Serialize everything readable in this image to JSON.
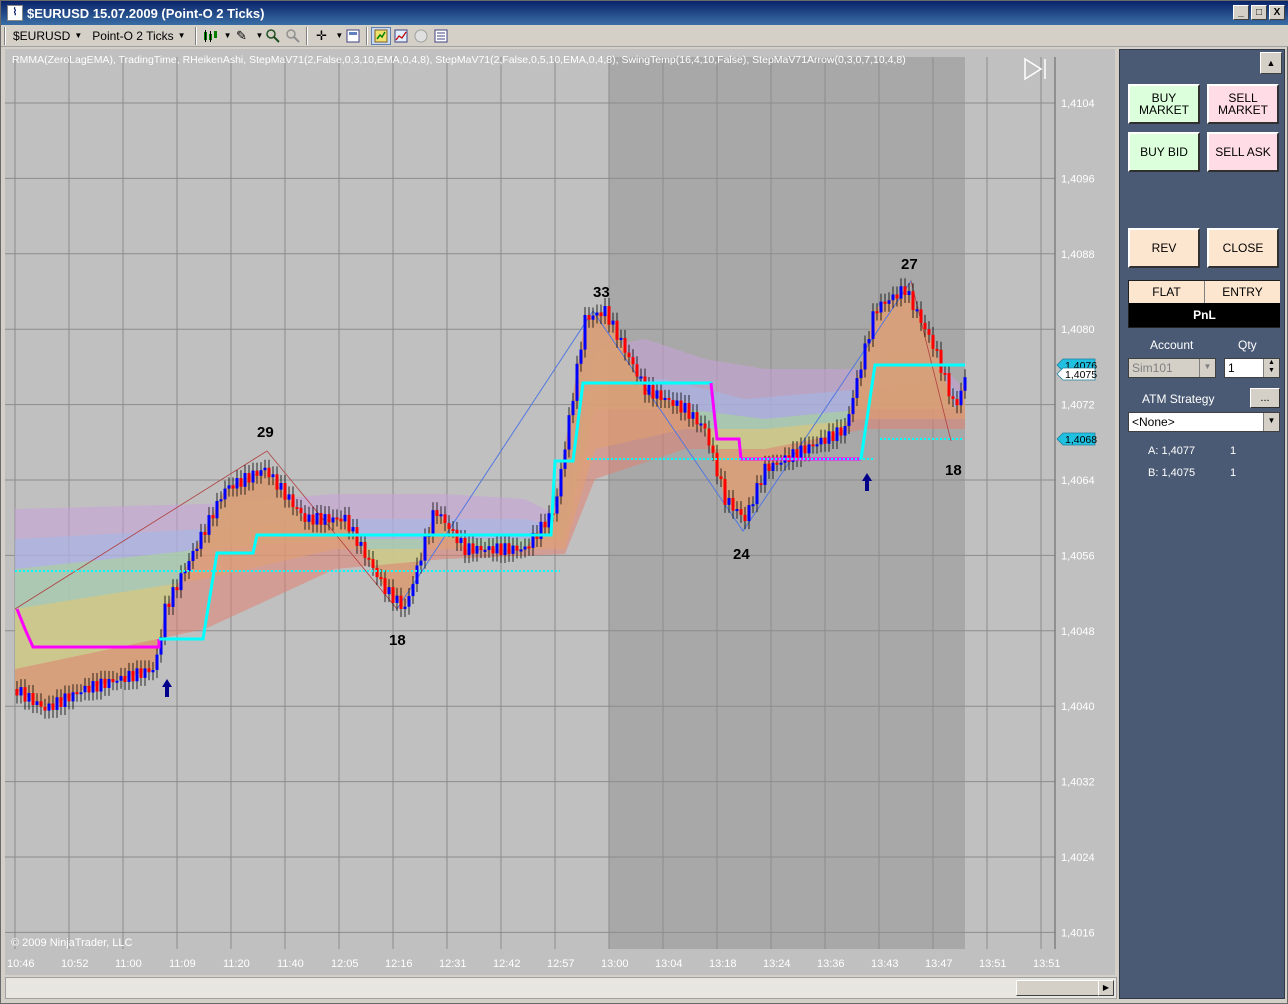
{
  "window": {
    "title": "$EURUSD  15.07.2009 (Point-O 2 Ticks)",
    "controls": [
      "_",
      "□",
      "X"
    ]
  },
  "toolbar": {
    "instrument": "$EURUSD",
    "period": "Point-O 2 Ticks"
  },
  "chart": {
    "indicator_label": "RMMA(ZeroLagEMA), TradingTime, RHeikenAshi, StepMaV71(2,False,0,3,10,EMA,0,4,8), StepMaV71(2,False,0,5,10,EMA,0,4,8), SwingTemp(16,4,10,False), StepMaV71Arrow(0,3,0,7,10,4,8)",
    "copyright": "© 2009 NinjaTrader, LLC",
    "price_ticks": [
      "1,4104",
      "1,4096",
      "1,4088",
      "1,4080",
      "1,4072",
      "1,4064",
      "1,4056",
      "1,4048",
      "1,4040",
      "1,4032",
      "1,4024",
      "1,4016"
    ],
    "time_ticks": [
      "10:46",
      "10:52",
      "11:00",
      "11:09",
      "11:20",
      "11:40",
      "12:05",
      "12:16",
      "12:31",
      "12:42",
      "12:57",
      "13:00",
      "13:04",
      "13:18",
      "13:24",
      "13:36",
      "13:43",
      "13:47",
      "13:51",
      "13:51"
    ],
    "price_markers": {
      "ask": "1,4076",
      "last": "1,4075",
      "stop": "1,4068"
    },
    "swing_labels": [
      "29",
      "18",
      "33",
      "24",
      "27",
      "18"
    ],
    "colors": {
      "background": "#c0c0c0",
      "session_shade": "#a8a8a8",
      "up_bar": "#0000ff",
      "down_bar": "#ff0000",
      "step_ma": "#00ffff",
      "step_ma_down": "#ff00ff",
      "arrow": "#00008b"
    }
  },
  "panel": {
    "buy_market": "BUY\nMARKET",
    "sell_market": "SELL\nMARKET",
    "buy_bid": "BUY BID",
    "sell_ask": "SELL ASK",
    "rev": "REV",
    "close": "CLOSE",
    "flat": "FLAT",
    "entry": "ENTRY",
    "pnl": "PnL",
    "account_label": "Account",
    "qty_label": "Qty",
    "account_value": "Sim101",
    "qty_value": "1",
    "atm_label": "ATM Strategy",
    "atm_btn": "...",
    "atm_value": "<None>",
    "ask_label": "A: 1,4077",
    "ask_qty": "1",
    "bid_label": "B: 1,4075",
    "bid_qty": "1"
  }
}
